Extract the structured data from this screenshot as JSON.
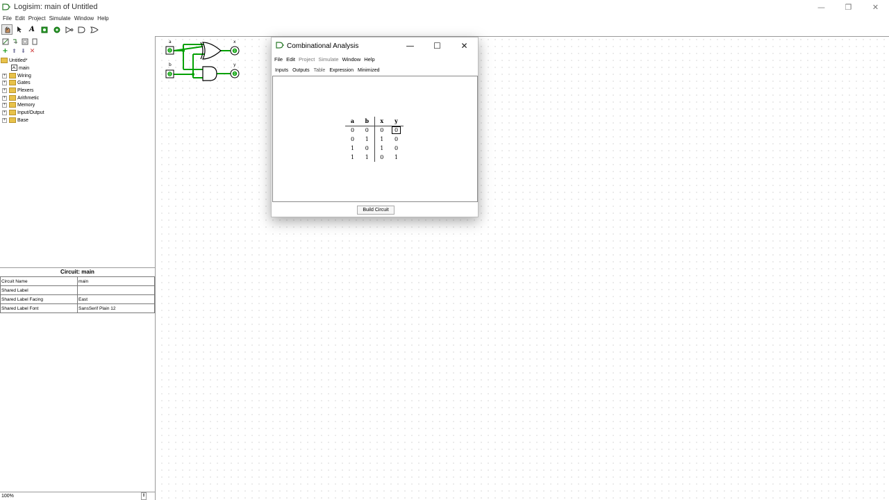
{
  "window": {
    "title": "Logisim: main of Untitled",
    "controls": [
      "—",
      "❐",
      "✕"
    ]
  },
  "menu": [
    "File",
    "Edit",
    "Project",
    "Simulate",
    "Window",
    "Help"
  ],
  "explorer": {
    "root": "Untitled*",
    "items": [
      {
        "label": "main",
        "type": "circuit"
      },
      {
        "label": "Wiring",
        "type": "folder"
      },
      {
        "label": "Gates",
        "type": "folder"
      },
      {
        "label": "Plexers",
        "type": "folder"
      },
      {
        "label": "Arithmetic",
        "type": "folder"
      },
      {
        "label": "Memory",
        "type": "folder"
      },
      {
        "label": "Input/Output",
        "type": "folder"
      },
      {
        "label": "Base",
        "type": "folder"
      }
    ]
  },
  "attributes": {
    "title": "Circuit: main",
    "rows": [
      {
        "key": "Circuit Name",
        "value": "main"
      },
      {
        "key": "Shared Label",
        "value": ""
      },
      {
        "key": "Shared Label Facing",
        "value": "East"
      },
      {
        "key": "Shared Label Font",
        "value": "SansSerif Plain 12"
      }
    ]
  },
  "zoom": "100%",
  "circuit": {
    "inputs": [
      "a",
      "b"
    ],
    "outputs": [
      "x",
      "y"
    ],
    "wire_color": "#00a000"
  },
  "dialog": {
    "title": "Combinational Analysis",
    "menu": [
      "File",
      "Edit",
      "Project",
      "Simulate",
      "Window",
      "Help"
    ],
    "tabs": [
      "Inputs",
      "Outputs",
      "Table",
      "Expression",
      "Minimized"
    ],
    "active_tab": "Table",
    "truth_table": {
      "headers": [
        "a",
        "b",
        "x",
        "y"
      ],
      "rows": [
        [
          "0",
          "0",
          "0",
          "0"
        ],
        [
          "0",
          "1",
          "1",
          "0"
        ],
        [
          "1",
          "0",
          "1",
          "0"
        ],
        [
          "1",
          "1",
          "0",
          "1"
        ]
      ]
    },
    "build_button": "Build Circuit"
  }
}
